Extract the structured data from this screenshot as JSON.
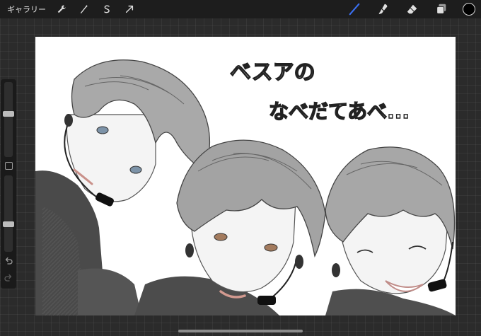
{
  "toolbar": {
    "gallery_label": "ギャラリー",
    "actions": [
      "wrench-icon",
      "magic-wand-icon",
      "selection-s-icon",
      "transform-arrow-icon"
    ],
    "right_tools": [
      "brush-icon",
      "smudge-icon",
      "eraser-icon",
      "layers-icon"
    ],
    "active_tool": "brush-icon",
    "accent_color": "#3a6ff0",
    "current_color": "#000000"
  },
  "sidebar": {
    "size_slider": 0.58,
    "opacity_slider": 0.35
  },
  "artwork": {
    "handwritten_text_line1": "ベスアの",
    "handwritten_text_line2": "なべだてあべ..."
  }
}
